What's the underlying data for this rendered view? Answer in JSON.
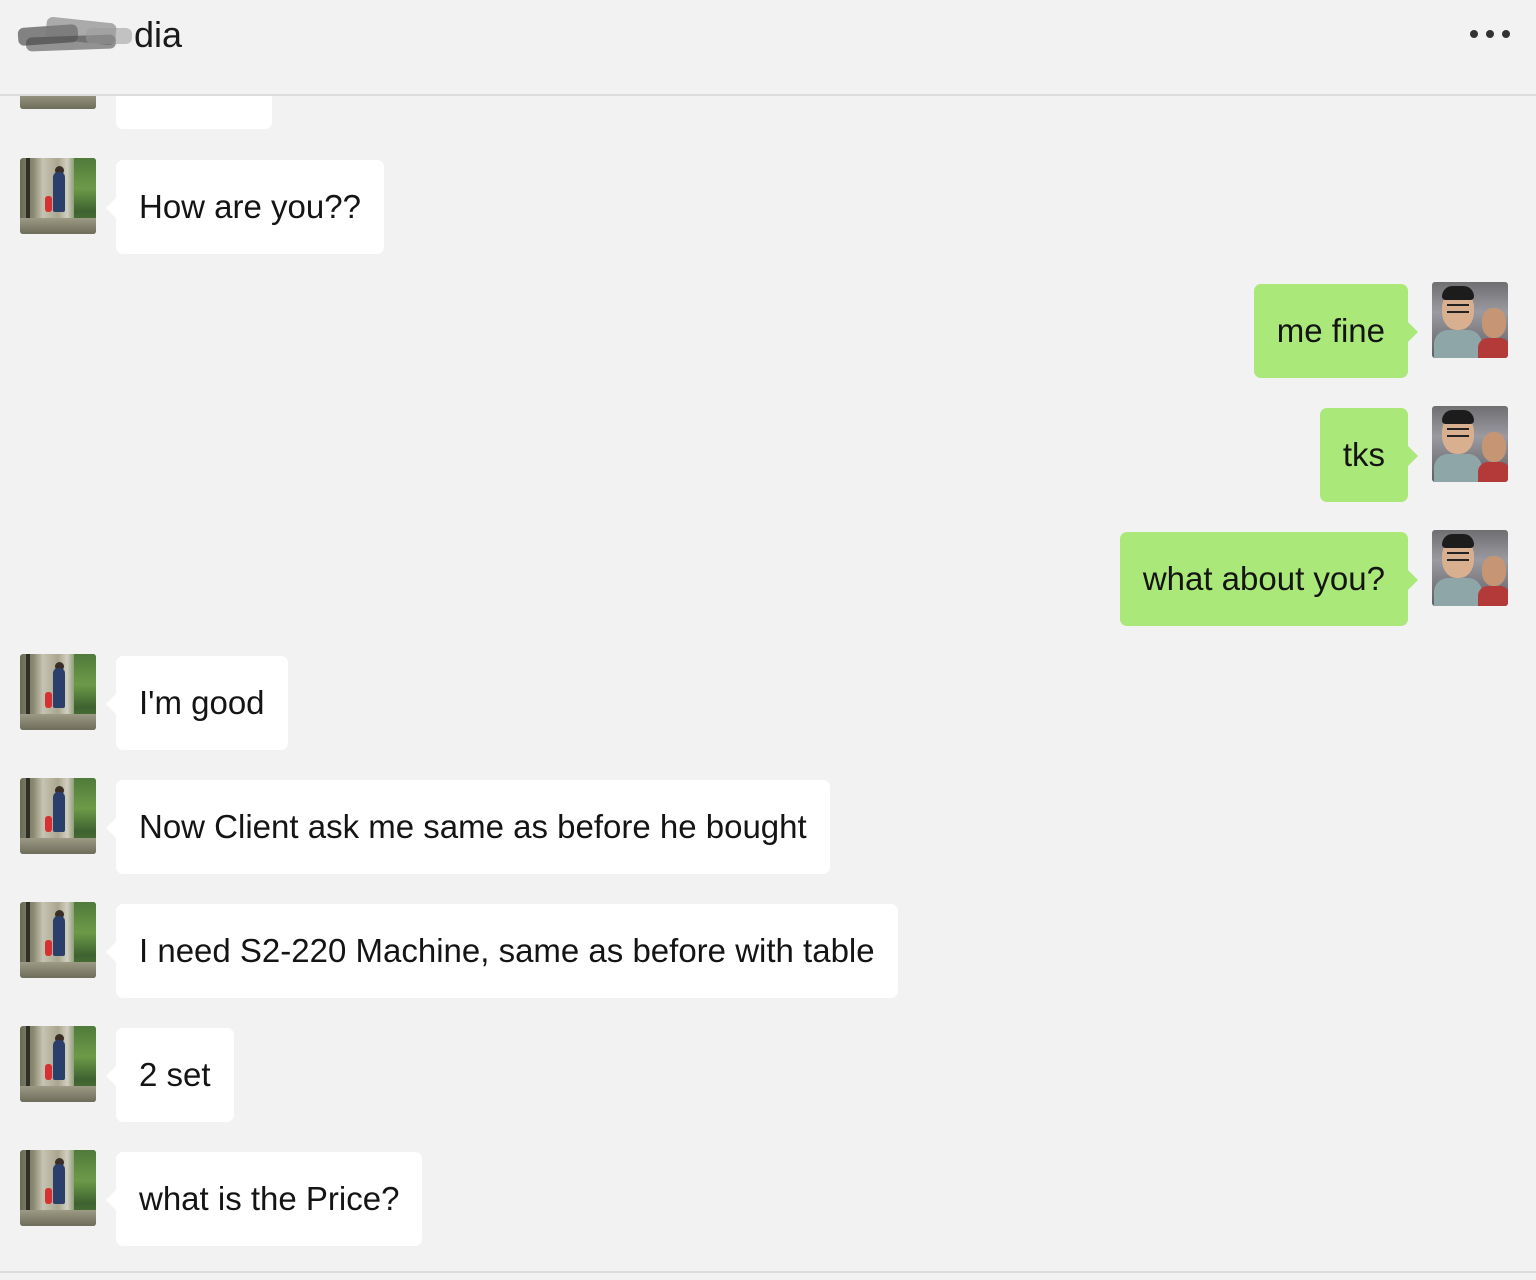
{
  "header": {
    "title": "dia"
  },
  "colors": {
    "background": "#f2f2f2",
    "incoming_bubble": "#ffffff",
    "outgoing_bubble": "#a9e879"
  },
  "messages": [
    {
      "side": "left",
      "text": ""
    },
    {
      "side": "left",
      "text": "How are you??"
    },
    {
      "side": "right",
      "text": "me fine"
    },
    {
      "side": "right",
      "text": "tks"
    },
    {
      "side": "right",
      "text": "what about you?"
    },
    {
      "side": "left",
      "text": "I'm good"
    },
    {
      "side": "left",
      "text": "Now Client ask me same as before he bought"
    },
    {
      "side": "left",
      "text": "I need S2-220 Machine, same as before with table"
    },
    {
      "side": "left",
      "text": "2 set"
    },
    {
      "side": "left",
      "text": "what is the Price?"
    }
  ],
  "icons": {
    "menu": "more-icon"
  }
}
